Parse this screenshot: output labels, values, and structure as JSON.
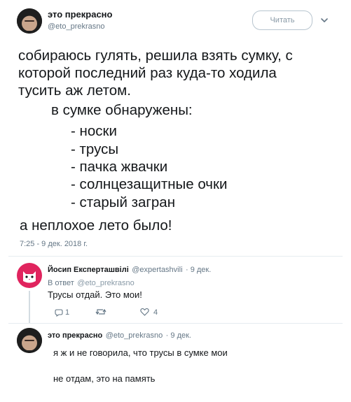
{
  "tweet": {
    "author_name": "это прекрасно",
    "author_handle": "@eto_prekrasno",
    "follow_label": "Читать",
    "text_lines": [
      "собираюсь гулять, решила взять сумку, с",
      "которой последний раз куда-то ходила",
      "тусить аж летом.",
      "в сумке обнаружены:",
      "- носки",
      "- трусы",
      "- пачка жвачки",
      "- солнцезащитные очки",
      "- старый загран",
      "а неплохое лето было!"
    ],
    "timestamp": "7:25 - 9 дек. 2018 г."
  },
  "reply1": {
    "author_name": "Йосип Експерташвілі",
    "author_handle": "@expertashvili",
    "date": "· 9 дек.",
    "in_reply_prefix": "В ответ",
    "in_reply_handle": "@eto_prekrasno",
    "text": "Трусы отдай. Это мои!",
    "reply_count": "1",
    "like_count": "4",
    "icons": [
      "reply-icon",
      "retweet-icon",
      "like-icon"
    ]
  },
  "reply2": {
    "author_name": "это прекрасно",
    "author_handle": "@eto_prekrasno",
    "date": "· 9 дек.",
    "text_line1": "я ж и не говорила, что трусы в сумке мои",
    "text_line2": "не отдам, это  на память"
  },
  "colors": {
    "text": "#14171a",
    "muted": "#657786",
    "link": "#1b95e0",
    "accent_avatar": "#e0245e",
    "divider": "#e6ecf0"
  }
}
